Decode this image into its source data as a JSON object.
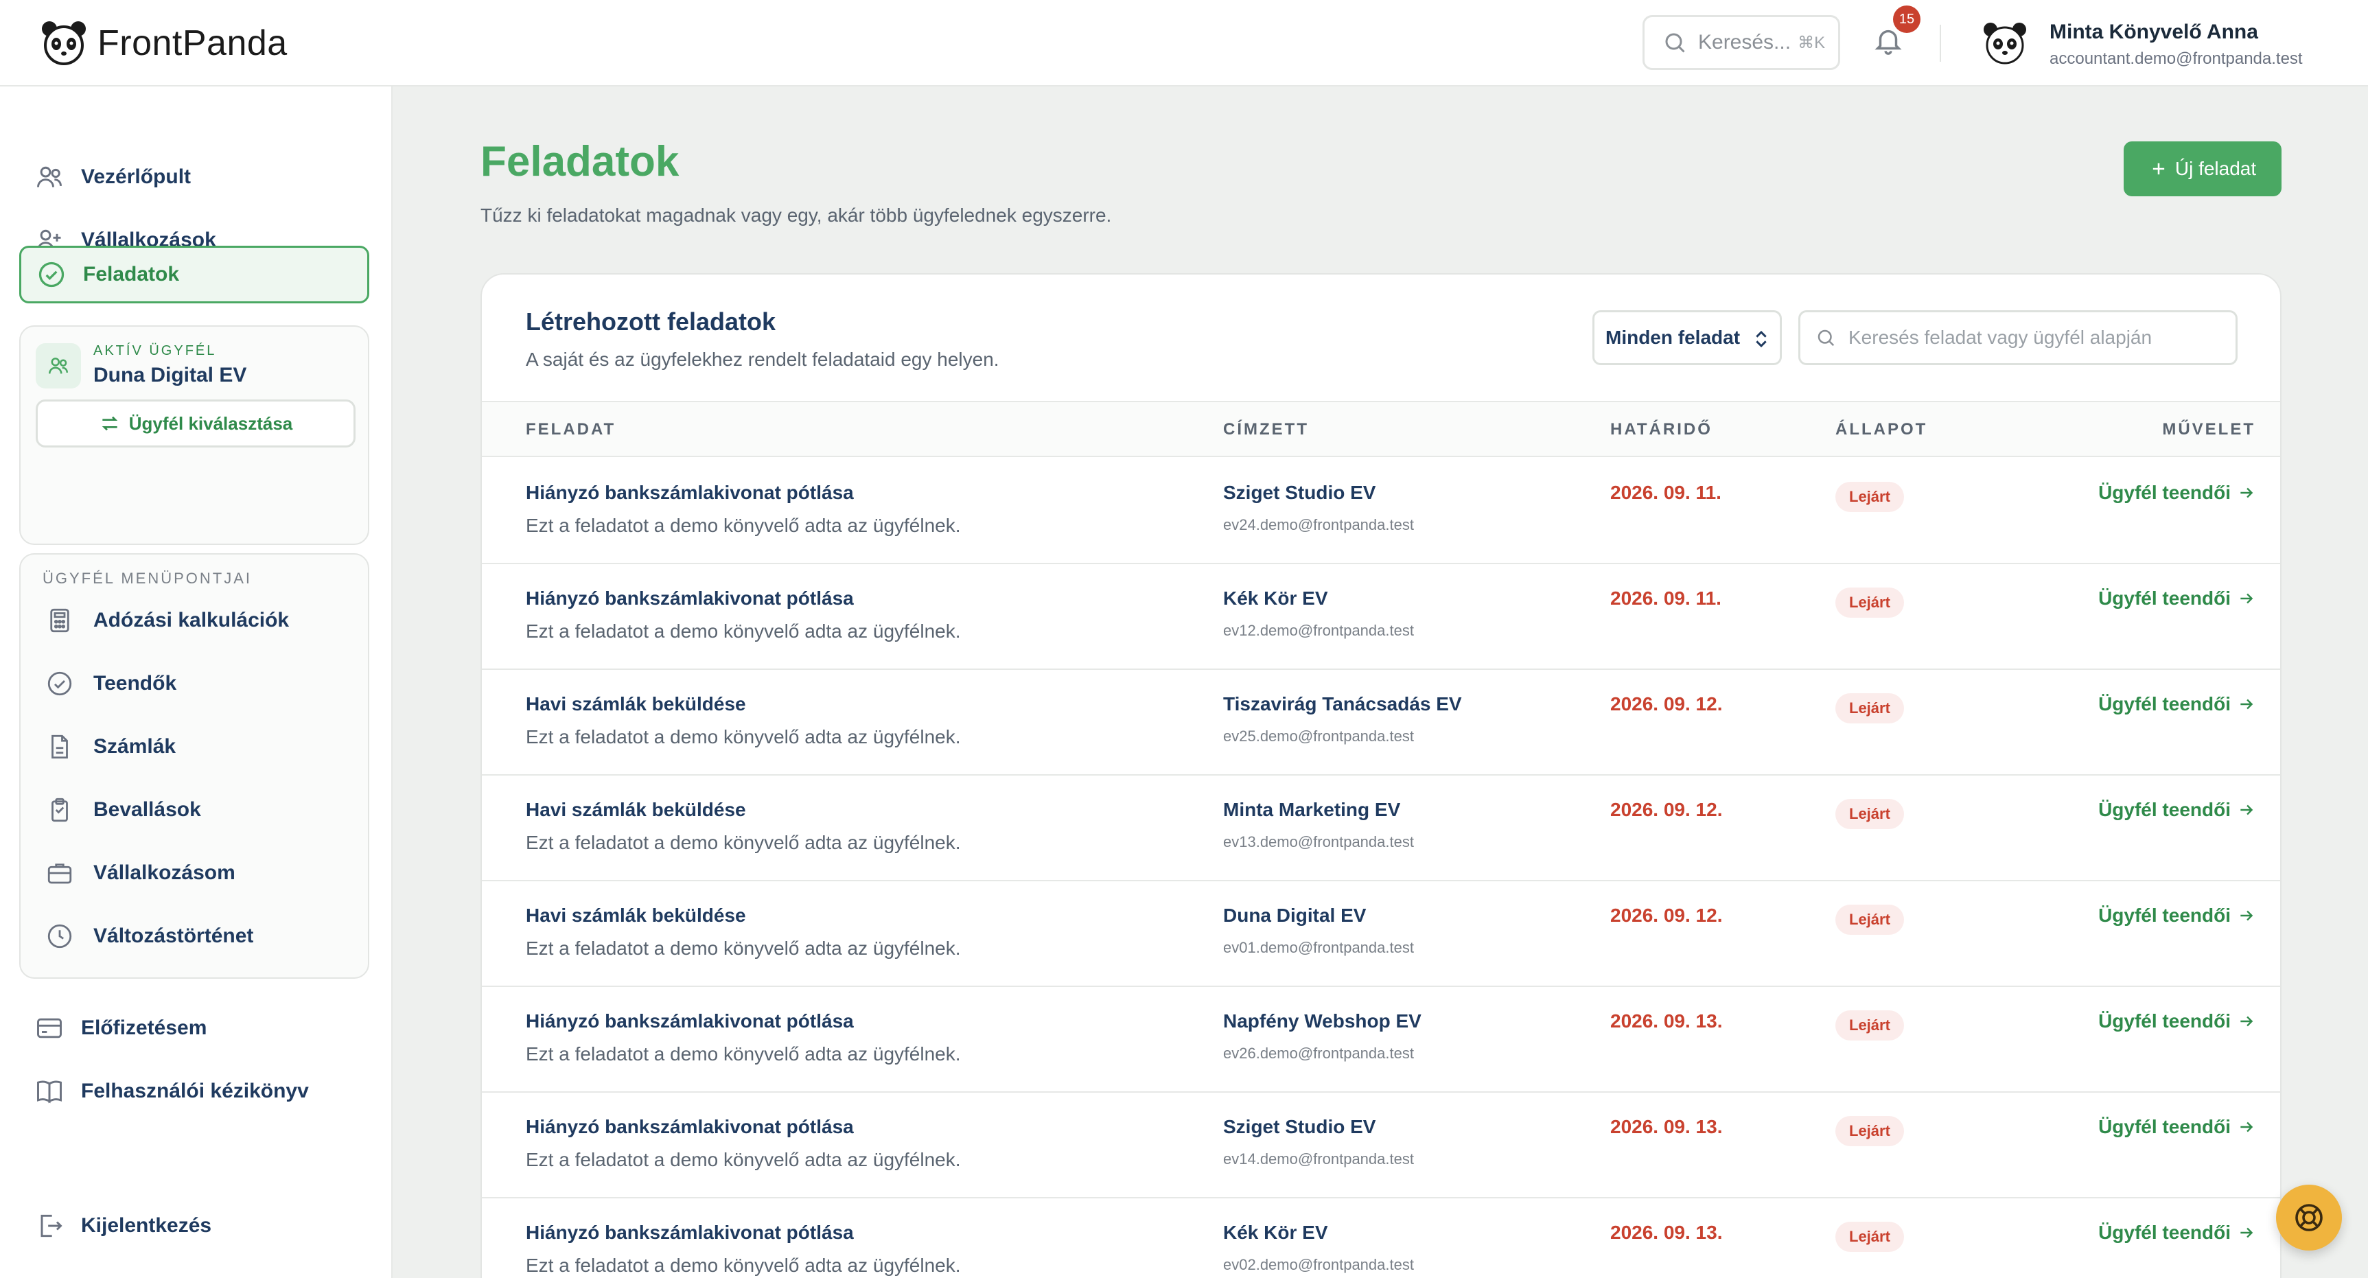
{
  "app": {
    "name": "FrontPanda"
  },
  "header": {
    "search_placeholder": "Keresés...",
    "search_shortcut": "⌘K",
    "notification_count": "15",
    "user_name": "Minta Könyvelő Anna",
    "user_email": "accountant.demo@frontpanda.test"
  },
  "sidebar": {
    "items": [
      {
        "label": "Vezérlőpult",
        "icon": "users-icon"
      },
      {
        "label": "Vállalkozások",
        "icon": "user-plus-icon"
      },
      {
        "label": "Feladatok",
        "icon": "check-circle-icon",
        "active": true
      }
    ],
    "client": {
      "label": "AKTÍV ÜGYFÉL",
      "name": "Duna Digital EV",
      "select_button": "Ügyfél kiválasztása"
    },
    "submenu_title": "ÜGYFÉL MENÜPONTJAI",
    "submenu": [
      {
        "label": "Adózási kalkulációk",
        "icon": "calculator-icon"
      },
      {
        "label": "Teendők",
        "icon": "check-circle-icon"
      },
      {
        "label": "Számlák",
        "icon": "document-icon"
      },
      {
        "label": "Bevallások",
        "icon": "clipboard-icon"
      },
      {
        "label": "Vállalkozásom",
        "icon": "briefcase-icon"
      },
      {
        "label": "Változástörténet",
        "icon": "clock-icon"
      }
    ],
    "bottom": [
      {
        "label": "Előfizetésem",
        "icon": "credit-card-icon"
      },
      {
        "label": "Felhasználói kézikönyv",
        "icon": "book-icon"
      }
    ],
    "logout": "Kijelentkezés"
  },
  "page": {
    "title": "Feladatok",
    "subtitle": "Tűzz ki feladatokat magadnak vagy egy, akár több ügyfelednek egyszerre.",
    "new_button": "Új feladat"
  },
  "tasks_card": {
    "title": "Létrehozott feladatok",
    "subtitle": "A saját és az ügyfelekhez rendelt feladataid egy helyen.",
    "filter_value": "Minden feladat",
    "search_placeholder": "Keresés feladat vagy ügyfél alapján",
    "columns": [
      "FELADAT",
      "CÍMZETT",
      "HATÁRIDŐ",
      "ÁLLAPOT",
      "MŰVELET"
    ],
    "rows": [
      {
        "title": "Hiányzó bankszámlakivonat pótlása",
        "desc": "Ezt a feladatot a demo könyvelő adta az ügyfélnek.",
        "name": "Sziget Studio EV",
        "email": "ev24.demo@frontpanda.test",
        "date": "2026. 09. 11.",
        "status": "Lejárt",
        "action": "Ügyfél teendői"
      },
      {
        "title": "Hiányzó bankszámlakivonat pótlása",
        "desc": "Ezt a feladatot a demo könyvelő adta az ügyfélnek.",
        "name": "Kék Kör EV",
        "email": "ev12.demo@frontpanda.test",
        "date": "2026. 09. 11.",
        "status": "Lejárt",
        "action": "Ügyfél teendői"
      },
      {
        "title": "Havi számlák beküldése",
        "desc": "Ezt a feladatot a demo könyvelő adta az ügyfélnek.",
        "name": "Tiszavirág Tanácsadás EV",
        "email": "ev25.demo@frontpanda.test",
        "date": "2026. 09. 12.",
        "status": "Lejárt",
        "action": "Ügyfél teendői"
      },
      {
        "title": "Havi számlák beküldése",
        "desc": "Ezt a feladatot a demo könyvelő adta az ügyfélnek.",
        "name": "Minta Marketing EV",
        "email": "ev13.demo@frontpanda.test",
        "date": "2026. 09. 12.",
        "status": "Lejárt",
        "action": "Ügyfél teendői"
      },
      {
        "title": "Havi számlák beküldése",
        "desc": "Ezt a feladatot a demo könyvelő adta az ügyfélnek.",
        "name": "Duna Digital EV",
        "email": "ev01.demo@frontpanda.test",
        "date": "2026. 09. 12.",
        "status": "Lejárt",
        "action": "Ügyfél teendői"
      },
      {
        "title": "Hiányzó bankszámlakivonat pótlása",
        "desc": "Ezt a feladatot a demo könyvelő adta az ügyfélnek.",
        "name": "Napfény Webshop EV",
        "email": "ev26.demo@frontpanda.test",
        "date": "2026. 09. 13.",
        "status": "Lejárt",
        "action": "Ügyfél teendői"
      },
      {
        "title": "Hiányzó bankszámlakivonat pótlása",
        "desc": "Ezt a feladatot a demo könyvelő adta az ügyfélnek.",
        "name": "Sziget Studio EV",
        "email": "ev14.demo@frontpanda.test",
        "date": "2026. 09. 13.",
        "status": "Lejárt",
        "action": "Ügyfél teendői"
      },
      {
        "title": "Hiányzó bankszámlakivonat pótlása",
        "desc": "Ezt a feladatot a demo könyvelő adta az ügyfélnek.",
        "name": "Kék Kör EV",
        "email": "ev02.demo@frontpanda.test",
        "date": "2026. 09. 13.",
        "status": "Lejárt",
        "action": "Ügyfél teendői"
      }
    ]
  },
  "colors": {
    "brand_green": "#4aa863",
    "overdue_red": "#c9412e",
    "help_button": "#f0b43e"
  }
}
